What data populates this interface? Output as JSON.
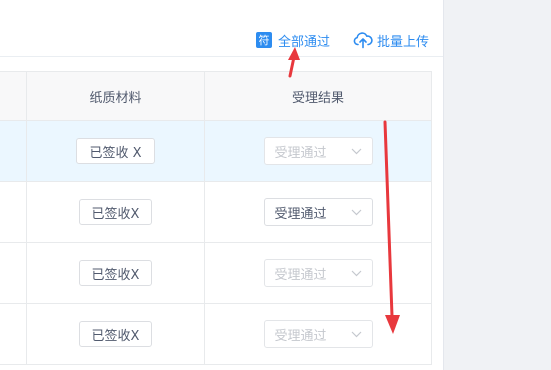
{
  "toolbar": {
    "approve_all": {
      "icon_char": "符",
      "label": "全部通过"
    },
    "batch_upload": {
      "label": "批量上传"
    }
  },
  "table": {
    "columns": [
      "",
      "纸质材料",
      "受理结果"
    ],
    "rows": [
      {
        "material_button": "已签收 X",
        "result": "受理通过",
        "result_enabled": false,
        "highlighted": true
      },
      {
        "material_button": "已签收X",
        "result": "受理通过",
        "result_enabled": true,
        "highlighted": false
      },
      {
        "material_button": "已签收X",
        "result": "受理通过",
        "result_enabled": false,
        "highlighted": false
      },
      {
        "material_button": "已签收X",
        "result": "受理通过",
        "result_enabled": false,
        "highlighted": false
      }
    ]
  },
  "colors": {
    "accent": "#2d8cf0",
    "annotation_arrow": "#e8383d",
    "row_highlight": "#ebf7ff"
  }
}
